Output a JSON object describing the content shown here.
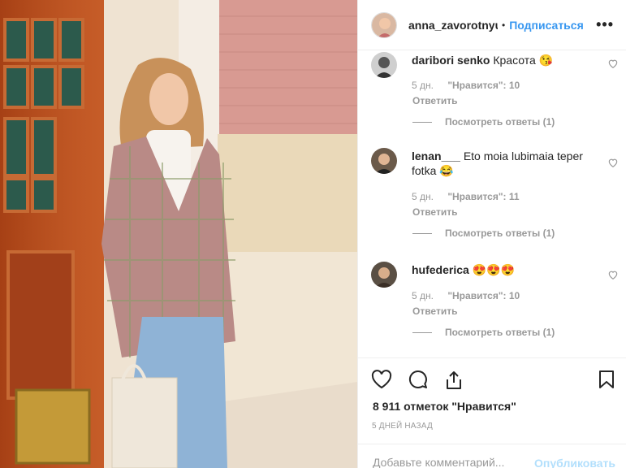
{
  "post": {
    "username": "anna_zavorotnyuk",
    "separator": "•",
    "follow_label": "Подписаться",
    "more_label": "•••"
  },
  "comments": [
    {
      "username": "daribori senko",
      "text": "Красота 😘",
      "age": "5 дн.",
      "likes": "\"Нравится\": 10",
      "reply_label": "Ответить",
      "view_replies": "Посмотреть ответы (1)"
    },
    {
      "username": "lenan___",
      "text": "Eto moia lubimaia teper fotka 😂",
      "age": "5 дн.",
      "likes": "\"Нравится\": 11",
      "reply_label": "Ответить",
      "view_replies": "Посмотреть ответы (1)"
    },
    {
      "username": "hufederica",
      "text": "😍😍😍",
      "age": "5 дн.",
      "likes": "\"Нравится\": 10",
      "reply_label": "Ответить",
      "view_replies": "Посмотреть ответы (1)"
    }
  ],
  "actions": {
    "likes_text": "8 911 отметок \"Нравится\"",
    "date_text": "5 ДНЕЙ НАЗАД",
    "icons": [
      "heart-icon",
      "comment-icon",
      "share-icon",
      "bookmark-icon"
    ]
  },
  "add_comment": {
    "placeholder": "Добавьте комментарий...",
    "publish_label": "Опубликовать"
  },
  "colors": {
    "accent": "#3897f0",
    "publish_disabled": "#b2dffc",
    "text": "#262626",
    "muted": "#999999"
  }
}
